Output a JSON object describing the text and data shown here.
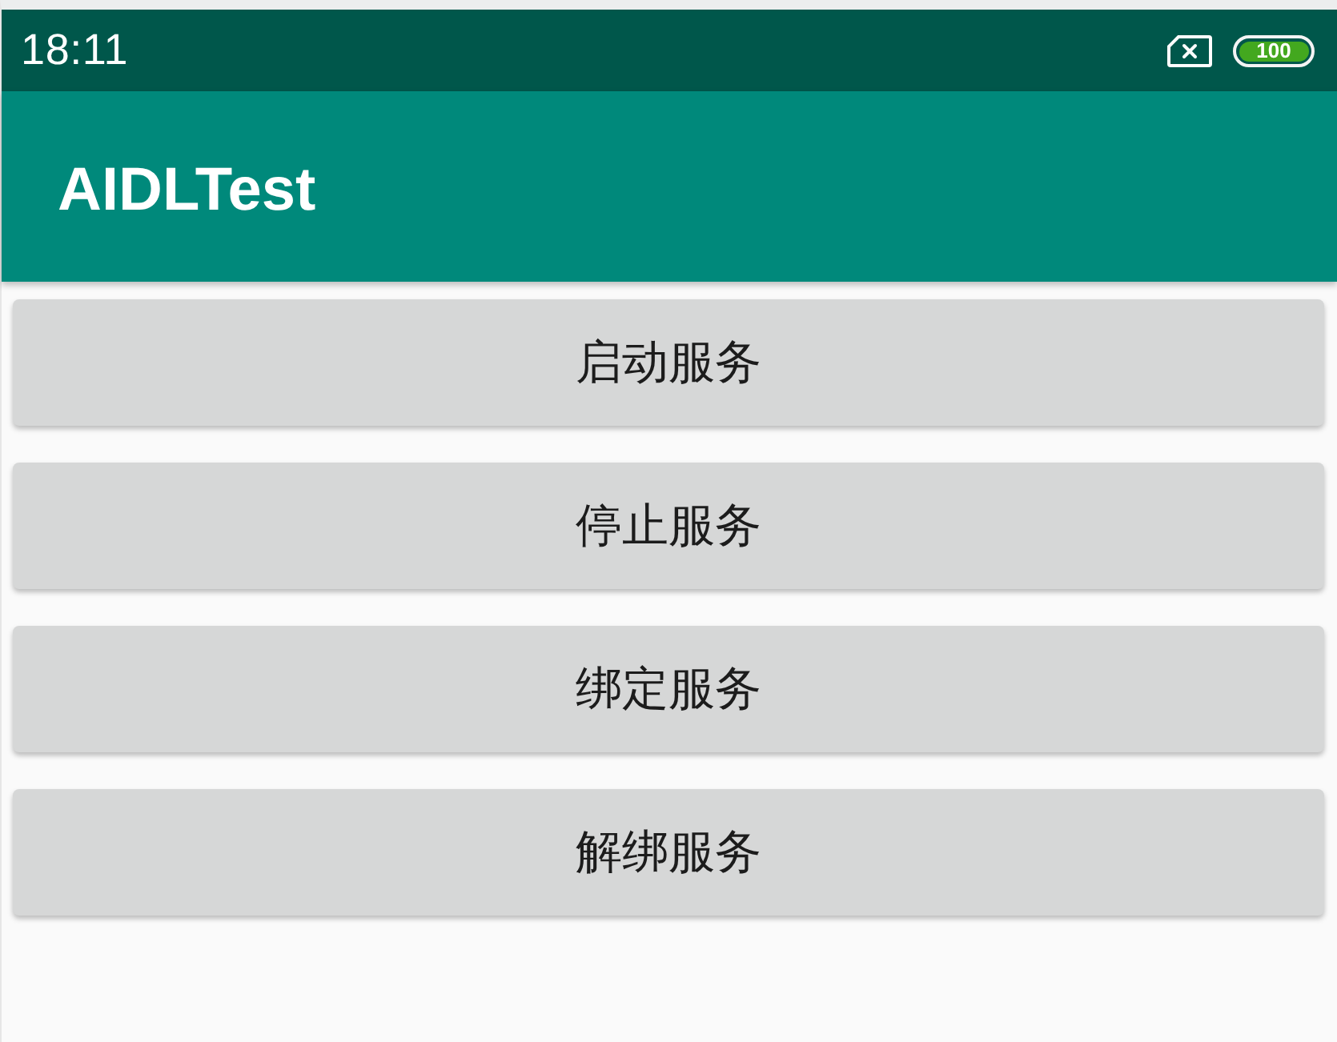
{
  "status_bar": {
    "time": "18:11",
    "battery": "100"
  },
  "app_bar": {
    "title": "AIDLTest"
  },
  "buttons": [
    {
      "label": "启动服务"
    },
    {
      "label": "停止服务"
    },
    {
      "label": "绑定服务"
    },
    {
      "label": "解绑服务"
    }
  ]
}
